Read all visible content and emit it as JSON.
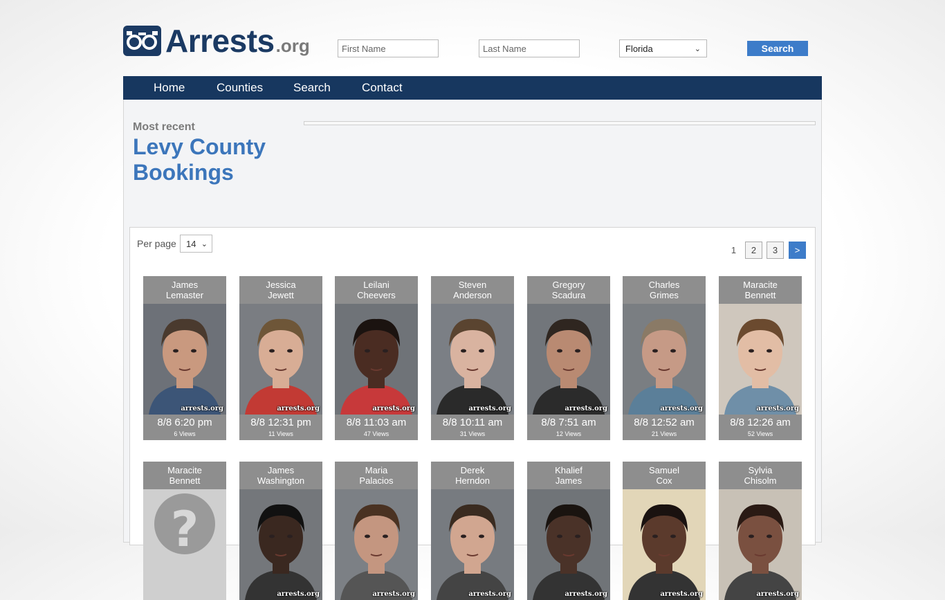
{
  "header": {
    "logo_text": "Arrests",
    "logo_suffix": ".org",
    "first_name_placeholder": "First Name",
    "last_name_placeholder": "Last Name",
    "state_selected": "Florida",
    "search_label": "Search"
  },
  "nav": {
    "items": [
      "Home",
      "Counties",
      "Search",
      "Contact"
    ]
  },
  "intro": {
    "kicker": "Most recent",
    "title": "Levy County Bookings"
  },
  "listing": {
    "per_page_label": "Per page",
    "per_page_value": "14",
    "pagination": [
      "1",
      "2",
      "3",
      ">"
    ],
    "watermark": "arrests.org",
    "cards": [
      {
        "first": "James",
        "last": "Lemaster",
        "time": "8/8 6:20 pm",
        "views": "6 Views",
        "bg": "#6d7178",
        "skin": "#c9997f",
        "hair": "#4a3a2e",
        "shirt": "#3c5577"
      },
      {
        "first": "Jessica",
        "last": "Jewett",
        "time": "8/8 12:31 pm",
        "views": "11 Views",
        "bg": "#7a7d82",
        "skin": "#d8ad95",
        "hair": "#6e5638",
        "shirt": "#c23a34"
      },
      {
        "first": "Leilani",
        "last": "Cheevers",
        "time": "8/8 11:03 am",
        "views": "47 Views",
        "bg": "#6f7378",
        "skin": "#4a2c22",
        "hair": "#1b1310",
        "shirt": "#c7393a"
      },
      {
        "first": "Steven",
        "last": "Anderson",
        "time": "8/8 10:11 am",
        "views": "31 Views",
        "bg": "#7b7f85",
        "skin": "#d9b3a0",
        "hair": "#5a4430",
        "shirt": "#2a2a2a"
      },
      {
        "first": "Gregory",
        "last": "Scadura",
        "time": "8/8 7:51 am",
        "views": "12 Views",
        "bg": "#72767b",
        "skin": "#b98a72",
        "hair": "#2f2620",
        "shirt": "#2b2b2b"
      },
      {
        "first": "Charles",
        "last": "Grimes",
        "time": "8/8 12:52 am",
        "views": "21 Views",
        "bg": "#7a7e82",
        "skin": "#c69a86",
        "hair": "#8a7a66",
        "shirt": "#5b7f99"
      },
      {
        "first": "Maracite",
        "last": "Bennett",
        "time": "8/8 12:26 am",
        "views": "52 Views",
        "bg": "#cfc7bd",
        "skin": "#e2bda5",
        "hair": "#6b4a2f",
        "shirt": "#6f8fa8"
      },
      {
        "first": "Maracite",
        "last": "Bennett",
        "time": "",
        "views": "",
        "bg": "#cfcfcf",
        "skin": "",
        "hair": "",
        "shirt": "",
        "placeholder": true
      },
      {
        "first": "James",
        "last": "Washington",
        "time": "",
        "views": "",
        "bg": "#74777b",
        "skin": "#3a2820",
        "hair": "#111111",
        "shirt": "#333333"
      },
      {
        "first": "Maria",
        "last": "Palacios",
        "time": "",
        "views": "",
        "bg": "#7c8085",
        "skin": "#c49680",
        "hair": "#4a3222",
        "shirt": "#555555"
      },
      {
        "first": "Derek",
        "last": "Herndon",
        "time": "",
        "views": "",
        "bg": "#777b80",
        "skin": "#d1a690",
        "hair": "#3a2b20",
        "shirt": "#444444"
      },
      {
        "first": "Khalief",
        "last": "James",
        "time": "",
        "views": "",
        "bg": "#707478",
        "skin": "#4a3228",
        "hair": "#1a1410",
        "shirt": "#333333"
      },
      {
        "first": "Samuel",
        "last": "Cox",
        "time": "",
        "views": "",
        "bg": "#e2d6b8",
        "skin": "#5b3a2c",
        "hair": "#1a1210",
        "shirt": "#333333"
      },
      {
        "first": "Sylvia",
        "last": "Chisolm",
        "time": "",
        "views": "",
        "bg": "#c8c1b6",
        "skin": "#7a5040",
        "hair": "#2a1a14",
        "shirt": "#444444"
      }
    ]
  }
}
